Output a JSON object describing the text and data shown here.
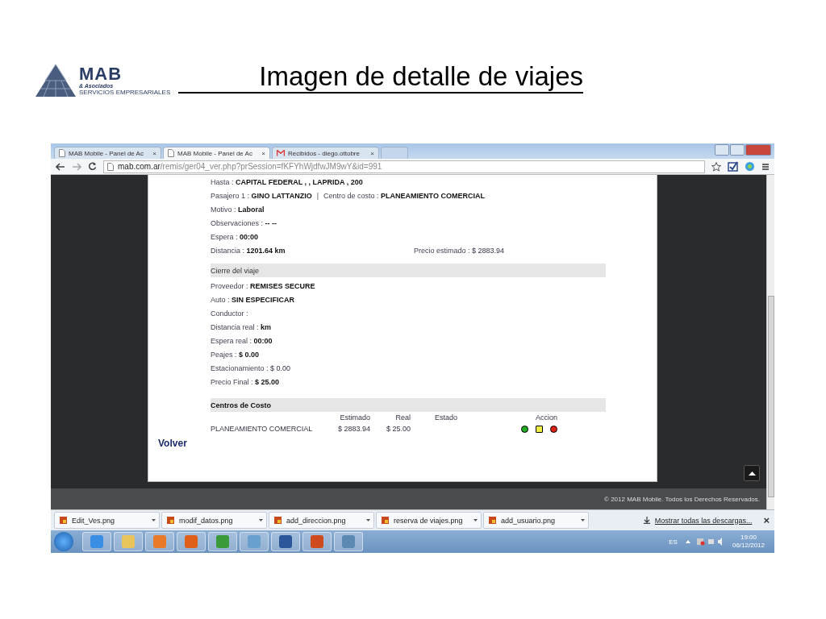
{
  "slide": {
    "logo": {
      "name": "MAB",
      "sub": "& Asociados",
      "tagline": "SERVICIOS EMPRESARIALES"
    },
    "title": "Imagen de detalle de viajes"
  },
  "browser": {
    "tabs": [
      {
        "title": "MAB Mobile - Panel de Ac",
        "selected": false,
        "kind": "page",
        "close": "×"
      },
      {
        "title": "MAB Mobile - Panel de Ac",
        "selected": true,
        "kind": "page",
        "close": "×"
      },
      {
        "title": "Recibidos - diego.ottobre",
        "selected": false,
        "kind": "mail",
        "close": "×"
      }
    ],
    "address": {
      "host": "mab.com.ar",
      "path": "/remis/ger04_ver.php?prSession=fKFYhWjdfwJM9wY&id=991"
    }
  },
  "trip": {
    "rows": [
      {
        "kind": "inline",
        "fields": [
          {
            "label": "Hasta :",
            "value": "CAPITAL FEDERAL , , LAPRIDA , 200",
            "bold": true
          }
        ]
      },
      {
        "kind": "inline",
        "separator": "|",
        "fields": [
          {
            "label": "Pasajero 1 :",
            "value": "GINO LATTANZIO",
            "bold": true
          },
          {
            "label": "Centro de costo :",
            "value": "PLANEAMIENTO COMERCIAL",
            "bold": true
          }
        ]
      },
      {
        "kind": "inline",
        "fields": [
          {
            "label": "Motivo :",
            "value": "Laboral",
            "bold": true
          }
        ]
      },
      {
        "kind": "inline",
        "fields": [
          {
            "label": "Observaciones :",
            "value": "-- --",
            "bold": true
          }
        ]
      },
      {
        "kind": "inline",
        "fields": [
          {
            "label": "Espera :",
            "value": "00:00",
            "bold": true
          }
        ]
      },
      {
        "kind": "columns",
        "fields": [
          {
            "label": "Distancia :",
            "value": "1201.64 km",
            "bold": true
          },
          {
            "label": "Precio estimado :",
            "value": "$ 2883.94",
            "bold": false
          }
        ]
      }
    ]
  },
  "closing": {
    "header": "Cierre del viaje",
    "rows": [
      {
        "label": "Proveedor :",
        "value": "REMISES SECURE",
        "bold": true
      },
      {
        "label": "Auto :",
        "value": "SIN ESPECIFICAR",
        "bold": true
      },
      {
        "label": "Conductor :"
      },
      {
        "label": "Distancia real :",
        "value": "km",
        "bold": true
      },
      {
        "label": "Espera real :",
        "value": "00:00",
        "bold": true
      },
      {
        "label": "Peajes :",
        "value": "$ 0.00",
        "bold": true
      },
      {
        "label": "Estacionamiento :",
        "value": "$ 0.00",
        "bold": false
      },
      {
        "label": "Precio Final :",
        "value": "$ 25.00",
        "bold": true
      }
    ]
  },
  "cost_centers": {
    "header": "Centros de Costo",
    "columns": [
      "Estimado",
      "Real",
      "Estado",
      "Accion"
    ],
    "rows": [
      {
        "name": "PLANEAMIENTO COMERCIAL",
        "estimado": "$ 2883.94",
        "real": "$ 25.00",
        "actions": [
          {
            "kind": "circle",
            "color": "#22aa22"
          },
          {
            "kind": "square",
            "color": "#eeee44"
          },
          {
            "kind": "circle",
            "color": "#dd2211"
          }
        ]
      }
    ]
  },
  "back_link": "Volver",
  "footer": "© 2012 MAB Mobile. Todos los Derechos Reservados.",
  "downloads": {
    "items": [
      "Edit_Ves.png",
      "modif_datos.png",
      "add_direccion.png",
      "reserva de viajes.png",
      "add_usuario.png"
    ],
    "show_all": "Mostrar todas las descargas...",
    "close": "×"
  },
  "taskbar": {
    "apps": [
      {
        "kind": "ie"
      },
      {
        "kind": "folder"
      },
      {
        "kind": "media"
      },
      {
        "kind": "firefox"
      },
      {
        "kind": "chrome"
      },
      {
        "kind": "people"
      },
      {
        "kind": "word"
      },
      {
        "kind": "powerpoint"
      },
      {
        "kind": "image"
      }
    ],
    "language": "ES",
    "time": "19:00",
    "date": "06/12/2012"
  }
}
